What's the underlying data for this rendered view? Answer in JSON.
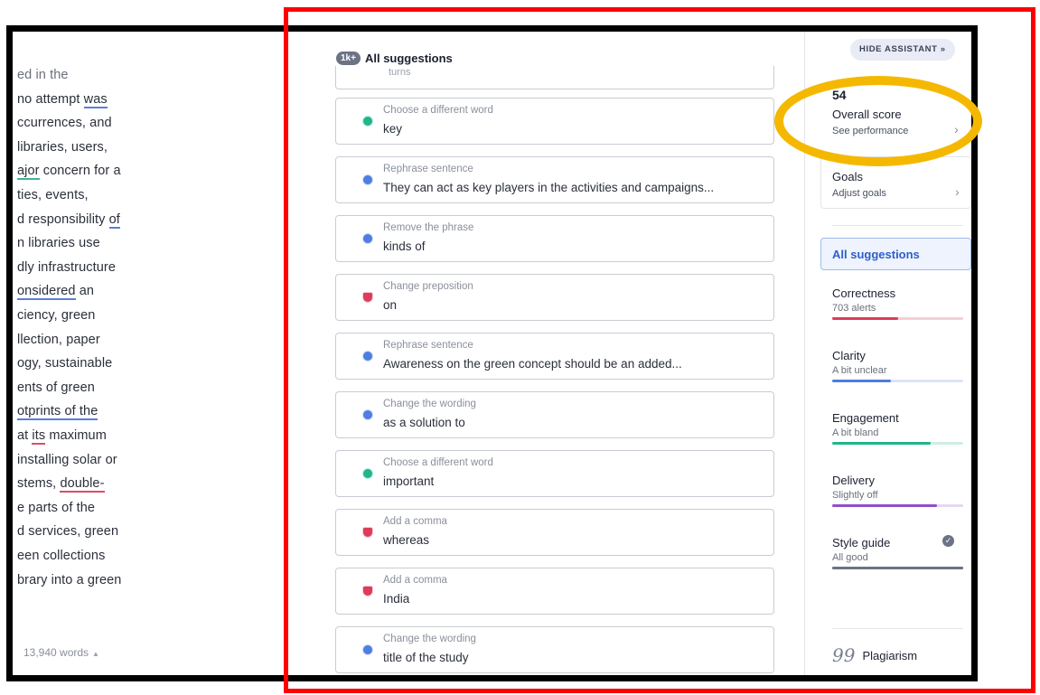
{
  "document": {
    "lines": [
      {
        "parts": [
          {
            "t": "ed in the"
          }
        ],
        "faded": true
      },
      {
        "parts": [
          {
            "t": "no attempt "
          },
          {
            "t": "was",
            "u": "blue"
          }
        ]
      },
      {
        "parts": [
          {
            "t": "ccurrences, and"
          }
        ]
      },
      {
        "parts": [
          {
            "t": " libraries, users,"
          }
        ]
      },
      {
        "parts": [
          {
            "t": "ajor",
            "u": "teal"
          },
          {
            "t": " concern for a"
          }
        ]
      },
      {
        "parts": [
          {
            "t": "ties, events,"
          }
        ]
      },
      {
        "parts": [
          {
            "t": "d responsibility "
          },
          {
            "t": "of",
            "u": "blue"
          }
        ]
      },
      {
        "parts": [
          {
            "t": "n libraries use"
          }
        ]
      },
      {
        "parts": [
          {
            "t": "dly infrastructure"
          }
        ]
      },
      {
        "parts": [
          {
            "t": "onsidered",
            "u": "blue"
          },
          {
            "t": " an"
          }
        ]
      },
      {
        "parts": [
          {
            "t": "ciency, green"
          }
        ]
      },
      {
        "parts": [
          {
            "t": "llection, paper"
          }
        ]
      },
      {
        "parts": [
          {
            "t": "ogy, sustainable"
          }
        ]
      },
      {
        "parts": [
          {
            "t": "ents of green"
          }
        ]
      },
      {
        "parts": [
          {
            "t": "otprints of the",
            "u": "blue"
          }
        ]
      },
      {
        "parts": [
          {
            "t": " at "
          },
          {
            "t": "its",
            "u": "red"
          },
          {
            "t": " maximum"
          }
        ]
      },
      {
        "parts": [
          {
            "t": " installing solar or"
          }
        ]
      },
      {
        "parts": [
          {
            "t": "stems, "
          },
          {
            "t": "double-",
            "u": "red"
          }
        ]
      },
      {
        "parts": [
          {
            "t": "e parts of the"
          }
        ]
      },
      {
        "parts": [
          {
            "t": "d services, green"
          }
        ]
      },
      {
        "parts": [
          {
            "t": "een collections"
          }
        ]
      },
      {
        "parts": [
          {
            "t": "brary into a green"
          }
        ]
      }
    ],
    "word_count": "13,940 words",
    "word_count_arrow": "▲"
  },
  "suggestions": {
    "count_badge": "1k+",
    "title": "All suggestions",
    "partial_top_text": "turns",
    "cards": [
      {
        "label": "Choose a different word",
        "text": "key",
        "category": "green"
      },
      {
        "label": "Rephrase sentence",
        "text": "They can act as key players in the activities and campaigns...",
        "category": "blue"
      },
      {
        "label": "Remove the phrase",
        "text": "kinds of",
        "category": "blue"
      },
      {
        "label": "Change preposition",
        "text": "on",
        "category": "red"
      },
      {
        "label": "Rephrase sentence",
        "text": "Awareness on the green concept should be an added...",
        "category": "blue"
      },
      {
        "label": "Change the wording",
        "text": "as a solution to",
        "category": "blue"
      },
      {
        "label": "Choose a different word",
        "text": "important",
        "category": "green"
      },
      {
        "label": "Add a comma",
        "text": "whereas",
        "category": "red"
      },
      {
        "label": "Add a comma",
        "text": "India",
        "category": "red"
      },
      {
        "label": "Change the wording",
        "text": "title of the study",
        "category": "blue"
      }
    ]
  },
  "sidebar": {
    "hide_button": "HIDE ASSISTANT",
    "hide_button_icon": "»",
    "score": "54",
    "score_label": "Overall score",
    "score_link": "See performance",
    "goals_title": "Goals",
    "goals_link": "Adjust goals",
    "all_suggestions": "All suggestions",
    "metrics": [
      {
        "name": "Correctness",
        "sub": "703 alerts",
        "color": "#dd3c5a",
        "track": "#f6cdd5",
        "level": 0.5
      },
      {
        "name": "Clarity",
        "sub": "A bit unclear",
        "color": "#4f7de0",
        "track": "#dbe5f8",
        "level": 0.45
      },
      {
        "name": "Engagement",
        "sub": "A bit bland",
        "color": "#1fb68a",
        "track": "#cfeee3",
        "level": 0.75
      },
      {
        "name": "Delivery",
        "sub": "Slightly off",
        "color": "#8e4fc9",
        "track": "#e6d8f3",
        "level": 0.8
      },
      {
        "name": "Style guide",
        "sub": "All good",
        "color": "#6b7385",
        "track": "#6b7385",
        "level": 1.0
      }
    ],
    "plagiarism_icon": "99",
    "plagiarism": "Plagiarism"
  },
  "highlight_colors": {
    "box": "#ff0000",
    "ring": "#f5b800"
  }
}
